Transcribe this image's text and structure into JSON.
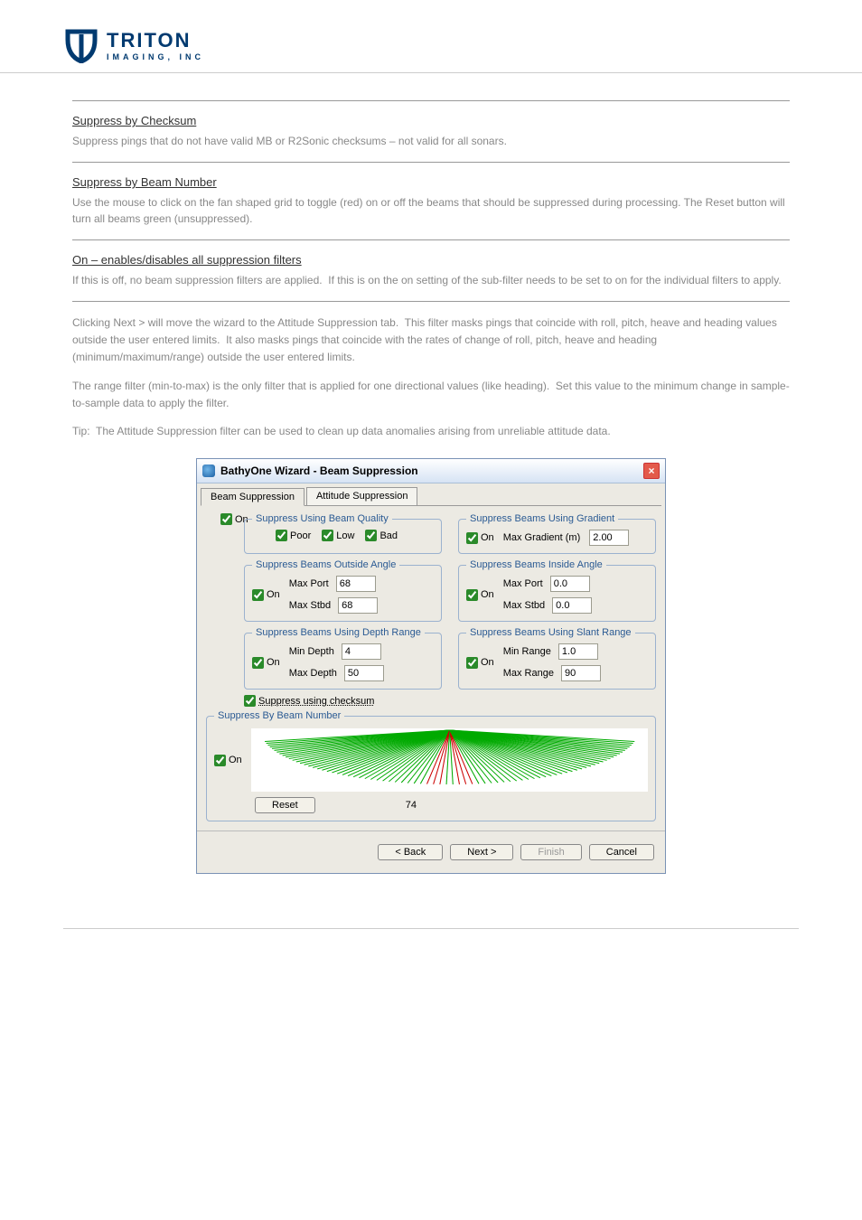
{
  "logo": {
    "name": "TRITON",
    "sub": "IMAGING, INC"
  },
  "sections": [
    {
      "title": "Suppress by Checksum",
      "body": "Suppress pings that do not have valid MB or R2Sonic checksums – not valid for all sonars."
    },
    {
      "title": "Suppress by Beam Number",
      "body": "Use the mouse to click on the fan shaped grid to toggle (red) on or off the beams that should be suppressed during processing. The Reset button will turn all beams green (unsuppressed)."
    },
    {
      "title": "On – enables/disables all suppression filters",
      "body": "If this is off, no beam suppression filters are applied.  If this is on the on setting of the sub-filter needs to be set to on for the individual filters to apply."
    }
  ],
  "paras": [
    "Clicking Next > will move the wizard to the Attitude Suppression tab.  This filter masks pings that coincide with roll, pitch, heave and heading values outside the user entered limits.  It also masks pings that coincide with the rates of change of roll, pitch, heave and heading (minimum/maximum/range) outside the user entered limits.",
    "The range filter (min-to-max) is the only filter that is applied for one directional values (like heading).  Set this value to the minimum change in sample-to-sample data to apply the filter.",
    "Tip:  The Attitude Suppression filter can be used to clean up data anomalies arising from unreliable attitude data."
  ],
  "dialog": {
    "title": "BathyOne Wizard - Beam Suppression",
    "close": "×",
    "tabs": [
      "Beam Suppression",
      "Attitude Suppression"
    ],
    "main_on": "On",
    "quality": {
      "legend": "Suppress Using Beam Quality",
      "opts": [
        "Poor",
        "Low",
        "Bad"
      ]
    },
    "gradient": {
      "legend": "Suppress Beams Using Gradient",
      "on": "On",
      "label": "Max Gradient (m)",
      "val": "2.00"
    },
    "outside": {
      "legend": "Suppress Beams Outside Angle",
      "on": "On",
      "rows": [
        {
          "label": "Max Port",
          "val": "68"
        },
        {
          "label": "Max Stbd",
          "val": "68"
        }
      ]
    },
    "inside": {
      "legend": "Suppress Beams Inside Angle",
      "on": "On",
      "rows": [
        {
          "label": "Max Port",
          "val": "0.0"
        },
        {
          "label": "Max Stbd",
          "val": "0.0"
        }
      ]
    },
    "depth": {
      "legend": "Suppress Beams Using Depth Range",
      "on": "On",
      "rows": [
        {
          "label": "Min Depth",
          "val": "4"
        },
        {
          "label": "Max Depth",
          "val": "50"
        }
      ]
    },
    "slant": {
      "legend": "Suppress Beams Using Slant Range",
      "on": "On",
      "rows": [
        {
          "label": "Min Range",
          "val": "1.0"
        },
        {
          "label": "Max Range",
          "val": "90"
        }
      ]
    },
    "checksum": {
      "label": "Suppress using checksum"
    },
    "beamnum": {
      "legend": "Suppress By Beam Number",
      "on": "On",
      "reset": "Reset",
      "count": "74"
    },
    "nav": {
      "back": "< Back",
      "next": "Next >",
      "finish": "Finish",
      "cancel": "Cancel"
    }
  }
}
